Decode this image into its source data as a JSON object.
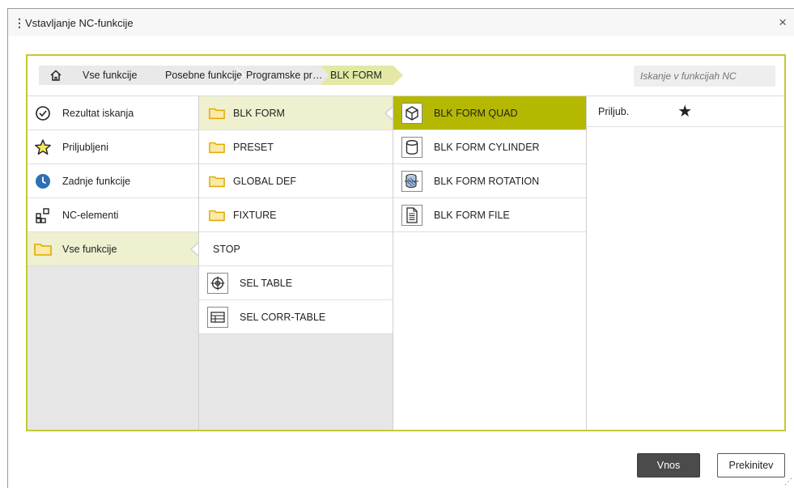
{
  "dialog": {
    "title": "Vstavljanje NC-funkcije",
    "close_symbol": "×",
    "drag_symbol": "⋮"
  },
  "breadcrumb": {
    "home_icon": "home-icon",
    "items": [
      "Vse funkcije",
      "Posebne funkcije",
      "Programske pr…",
      "BLK FORM"
    ]
  },
  "search": {
    "placeholder": "Iskanje v funkcijah NC"
  },
  "categories": [
    {
      "label": "Rezultat iskanja",
      "icon": "check-circle-icon"
    },
    {
      "label": "Priljubljeni",
      "icon": "star-outline-icon"
    },
    {
      "label": "Zadnje funkcije",
      "icon": "clock-icon"
    },
    {
      "label": "NC-elementi",
      "icon": "grid-icon"
    },
    {
      "label": "Vse funkcije",
      "icon": "folder-icon",
      "selected": true
    }
  ],
  "subcategories": [
    {
      "label": "BLK FORM",
      "type": "folder",
      "selected": true
    },
    {
      "label": "PRESET",
      "type": "folder"
    },
    {
      "label": "GLOBAL DEF",
      "type": "folder"
    },
    {
      "label": "FIXTURE",
      "type": "folder"
    },
    {
      "label": "STOP",
      "type": "function"
    },
    {
      "label": "SEL TABLE",
      "type": "function",
      "icon": "crosshair-icon"
    },
    {
      "label": "SEL CORR-TABLE",
      "type": "function",
      "icon": "table-icon"
    }
  ],
  "functions": [
    {
      "label": "BLK FORM QUAD",
      "icon": "cube-icon",
      "highlighted": true
    },
    {
      "label": "BLK FORM CYLINDER",
      "icon": "cylinder-icon"
    },
    {
      "label": "BLK FORM ROTATION",
      "icon": "rotation-icon"
    },
    {
      "label": "BLK FORM FILE",
      "icon": "file-icon"
    }
  ],
  "details": {
    "favorite_label": "Priljub.",
    "favorite_symbol": "★"
  },
  "buttons": {
    "ok": "Vnos",
    "cancel": "Prekinitev"
  },
  "colors": {
    "accent": "#c2cb33",
    "highlight": "#b5b800",
    "selected_bg": "#eef0cf",
    "folder": "#f2b800"
  }
}
